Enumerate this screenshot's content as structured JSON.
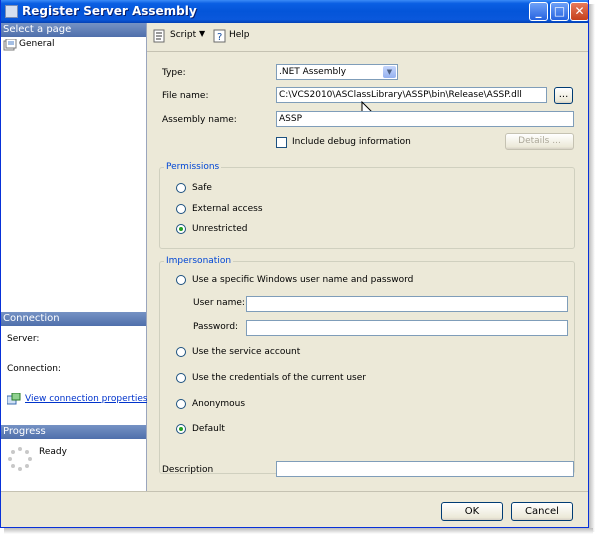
{
  "window": {
    "title": "Register Server Assembly"
  },
  "left_pane": {
    "select_page_header": "Select a page",
    "pages": [
      {
        "label": "General"
      }
    ],
    "connection_header": "Connection",
    "server_label": "Server:",
    "connection_label": "Connection:",
    "view_connection_link": "View connection properties",
    "progress_header": "Progress",
    "progress_status": "Ready"
  },
  "toolbar": {
    "script_label": "Script",
    "help_label": "Help"
  },
  "form": {
    "type_label": "Type:",
    "type_value": ".NET Assembly",
    "file_name_label": "File name:",
    "file_name_value": "C:\\VCS2010\\ASClassLibrary\\ASSP\\bin\\Release\\ASSP.dll",
    "browse_label": "...",
    "assembly_name_label": "Assembly name:",
    "assembly_name_value": "ASSP",
    "include_debug_label": "Include debug information",
    "details_label": "Details ...",
    "permissions": {
      "title": "Permissions",
      "options": [
        {
          "label": "Safe",
          "selected": false
        },
        {
          "label": "External access",
          "selected": false
        },
        {
          "label": "Unrestricted",
          "selected": true
        }
      ]
    },
    "impersonation": {
      "title": "Impersonation",
      "specific_user_label": "Use a specific Windows user name and password",
      "user_name_label": "User name:",
      "user_name_value": "",
      "password_label": "Password:",
      "password_value": "",
      "service_account_label": "Use the service account",
      "current_user_label": "Use the credentials of the current user",
      "anonymous_label": "Anonymous",
      "default_label": "Default",
      "selected": "Default"
    },
    "description_label": "Description",
    "description_value": ""
  },
  "footer": {
    "ok_label": "OK",
    "cancel_label": "Cancel"
  }
}
